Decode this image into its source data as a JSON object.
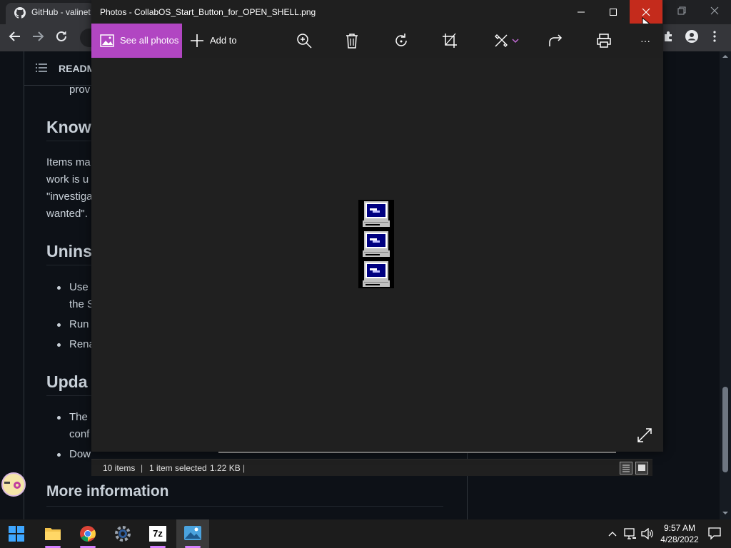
{
  "browser": {
    "tab_title": "GitHub - valinet",
    "readme_label": "READM",
    "content": {
      "line_prov": "prov",
      "heading_known": "Know",
      "para_line1": "Items ma",
      "para_line2": "work is u",
      "para_line3": "\"investiga",
      "para_line4": "wanted\".",
      "heading_uninstall": "Unins",
      "bullet_use": "Use",
      "bullet_use_cont": "the S",
      "bullet_run": "Run",
      "bullet_rename": "Rena",
      "heading_update": "Upda",
      "bullet_the": "The",
      "bullet_the_cont": "conf",
      "bullet_download": "Dow",
      "heading_more": "More information"
    }
  },
  "photos": {
    "window_title": "Photos - CollabOS_Start_Button_for_OPEN_SHELL.png",
    "see_all_label": "See all photos",
    "add_to_label": "Add to",
    "toolbar_icons": [
      "zoom-icon",
      "delete-icon",
      "rotate-icon",
      "crop-icon",
      "edit-icon",
      "share-icon",
      "print-icon",
      "more-icon"
    ],
    "more_label": "···"
  },
  "status_bar": {
    "items": "10 items",
    "selected": "1 item selected",
    "size": "1.22 KB"
  },
  "taskbar": {
    "apps": [
      "start-icon",
      "file-explorer-icon",
      "chrome-icon",
      "settings-icon",
      "7zip-icon",
      "photos-icon"
    ],
    "sevenzip_label": "7z",
    "time": "9:57 AM",
    "date": "4/28/2022"
  },
  "colors": {
    "accent": "#b146c2",
    "close_red": "#c42b1c",
    "github_bg": "#0d1117"
  }
}
